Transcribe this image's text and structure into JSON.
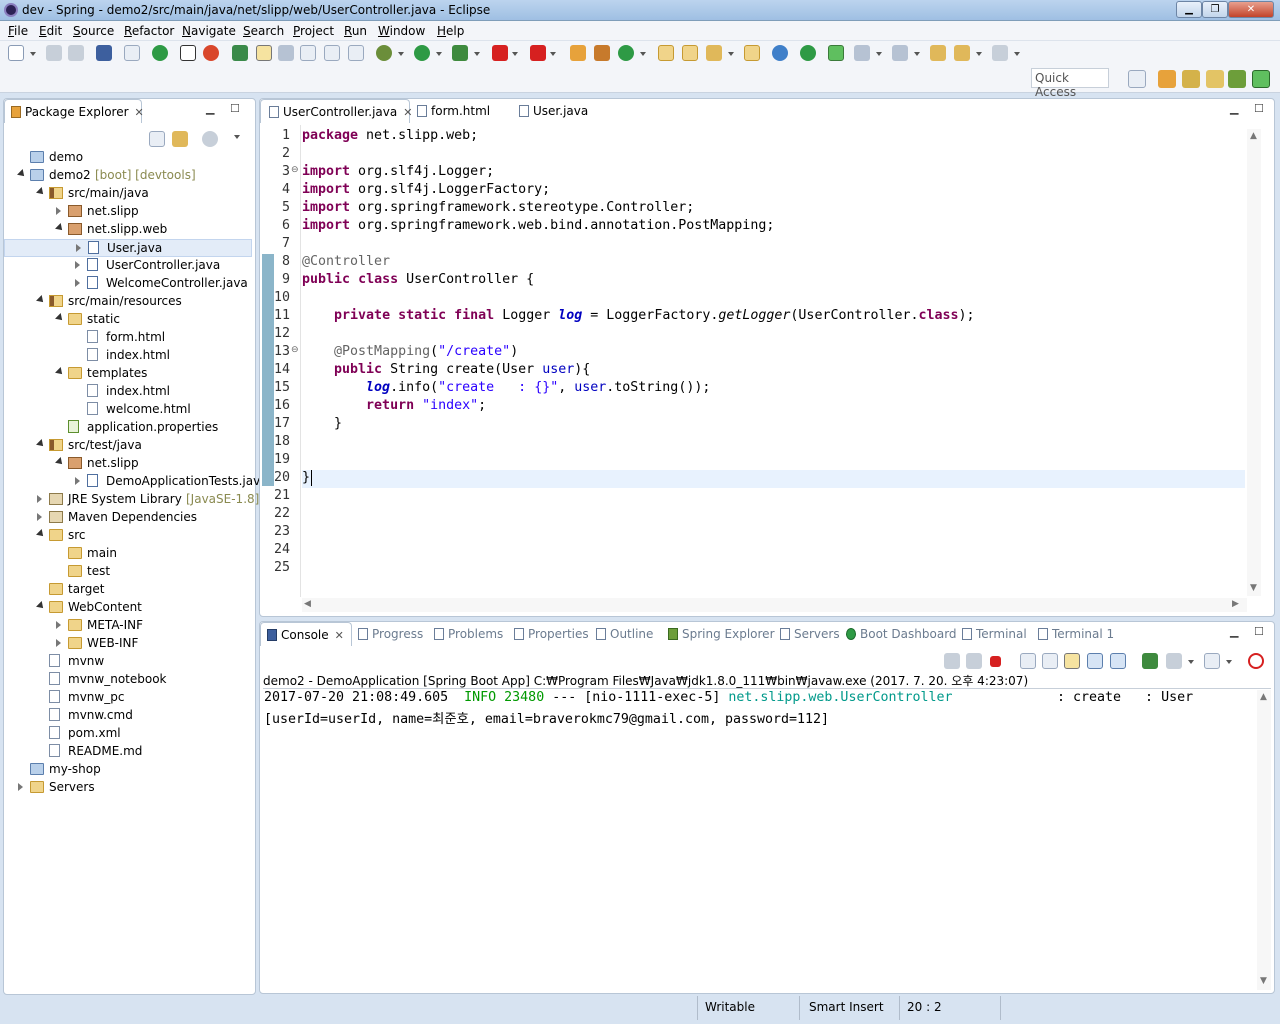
{
  "window": {
    "title": "dev - Spring - demo2/src/main/java/net/slipp/web/UserController.java - Eclipse"
  },
  "menu": [
    "File",
    "Edit",
    "Source",
    "Refactor",
    "Navigate",
    "Search",
    "Project",
    "Run",
    "Window",
    "Help"
  ],
  "toolbar": {
    "quick_access": "Quick Access"
  },
  "package_explorer": {
    "title": "Package Explorer",
    "tree": [
      {
        "label": "demo",
        "icon": "project-icon",
        "twisty": "none"
      },
      {
        "label": "demo2",
        "decoration": "[boot] [devtools]",
        "icon": "project-icon",
        "twisty": "open"
      },
      {
        "label": "src/main/java",
        "icon": "source-folder-icon",
        "twisty": "open"
      },
      {
        "label": "net.slipp",
        "icon": "package-icon",
        "twisty": "closed"
      },
      {
        "label": "net.slipp.web",
        "icon": "package-icon",
        "twisty": "open"
      },
      {
        "label": "User.java",
        "icon": "java-file-icon",
        "twisty": "closed"
      },
      {
        "label": "UserController.java",
        "icon": "java-file-icon",
        "twisty": "closed"
      },
      {
        "label": "WelcomeController.java",
        "icon": "java-file-icon",
        "twisty": "closed"
      },
      {
        "label": "src/main/resources",
        "icon": "source-folder-icon",
        "twisty": "open"
      },
      {
        "label": "static",
        "icon": "folder-icon",
        "twisty": "open"
      },
      {
        "label": "form.html",
        "icon": "html-file-icon",
        "twisty": "none"
      },
      {
        "label": "index.html",
        "icon": "html-file-icon",
        "twisty": "none"
      },
      {
        "label": "templates",
        "icon": "folder-icon",
        "twisty": "open"
      },
      {
        "label": "index.html",
        "icon": "html-file-icon",
        "twisty": "none"
      },
      {
        "label": "welcome.html",
        "icon": "html-file-icon",
        "twisty": "none"
      },
      {
        "label": "application.properties",
        "icon": "properties-file-icon",
        "twisty": "none"
      },
      {
        "label": "src/test/java",
        "icon": "source-folder-icon",
        "twisty": "open"
      },
      {
        "label": "net.slipp",
        "icon": "package-icon",
        "twisty": "open"
      },
      {
        "label": "DemoApplicationTests.java",
        "icon": "java-file-icon",
        "twisty": "closed"
      },
      {
        "label": "JRE System Library",
        "decoration": "[JavaSE-1.8]",
        "icon": "library-icon",
        "twisty": "closed"
      },
      {
        "label": "Maven Dependencies",
        "icon": "library-icon",
        "twisty": "closed"
      },
      {
        "label": "src",
        "icon": "folder-icon",
        "twisty": "open"
      },
      {
        "label": "main",
        "icon": "folder-icon",
        "twisty": "none"
      },
      {
        "label": "test",
        "icon": "folder-icon",
        "twisty": "none"
      },
      {
        "label": "target",
        "icon": "folder-icon",
        "twisty": "none"
      },
      {
        "label": "WebContent",
        "icon": "folder-icon",
        "twisty": "open"
      },
      {
        "label": "META-INF",
        "icon": "folder-icon",
        "twisty": "closed"
      },
      {
        "label": "WEB-INF",
        "icon": "folder-icon",
        "twisty": "closed"
      },
      {
        "label": "mvnw",
        "icon": "file-icon",
        "twisty": "none"
      },
      {
        "label": "mvnw_notebook",
        "icon": "file-icon",
        "twisty": "none"
      },
      {
        "label": "mvnw_pc",
        "icon": "file-icon",
        "twisty": "none"
      },
      {
        "label": "mvnw.cmd",
        "icon": "file-icon",
        "twisty": "none"
      },
      {
        "label": "pom.xml",
        "icon": "xml-file-icon",
        "twisty": "none"
      },
      {
        "label": "README.md",
        "icon": "file-icon",
        "twisty": "none"
      },
      {
        "label": "my-shop",
        "icon": "project-icon",
        "twisty": "none"
      },
      {
        "label": "Servers",
        "icon": "folder-icon",
        "twisty": "closed"
      }
    ]
  },
  "editor": {
    "tabs": [
      "UserController.java",
      "form.html",
      "User.java"
    ],
    "line_numbers": [
      "1",
      "2",
      "3",
      "4",
      "5",
      "6",
      "7",
      "8",
      "9",
      "10",
      "11",
      "12",
      "13",
      "14",
      "15",
      "16",
      "17",
      "18",
      "19",
      "20",
      "21",
      "22",
      "23",
      "24",
      "25"
    ],
    "code": [
      [
        {
          "t": "package",
          "k": "kw"
        },
        {
          "t": " net.slipp.web;"
        }
      ],
      [],
      [
        {
          "t": "import",
          "k": "kw"
        },
        {
          "t": " org.slf4j.Logger;"
        }
      ],
      [
        {
          "t": "import",
          "k": "kw"
        },
        {
          "t": " org.slf4j.LoggerFactory;"
        }
      ],
      [
        {
          "t": "import",
          "k": "kw"
        },
        {
          "t": " org.springframework.stereotype.Controller;"
        }
      ],
      [
        {
          "t": "import",
          "k": "kw"
        },
        {
          "t": " org.springframework.web.bind.annotation.PostMapping;"
        }
      ],
      [],
      [
        {
          "t": "@Controller",
          "k": "ann"
        }
      ],
      [
        {
          "t": "public",
          "k": "kw"
        },
        {
          "t": " "
        },
        {
          "t": "class",
          "k": "kw"
        },
        {
          "t": " UserController {"
        }
      ],
      [],
      [
        {
          "t": "    "
        },
        {
          "t": "private",
          "k": "kw"
        },
        {
          "t": " "
        },
        {
          "t": "static",
          "k": "kw"
        },
        {
          "t": " "
        },
        {
          "t": "final",
          "k": "kw"
        },
        {
          "t": " Logger "
        },
        {
          "t": "log",
          "k": "fld"
        },
        {
          "t": " = LoggerFactory."
        },
        {
          "t": "getLogger",
          "k": "stat"
        },
        {
          "t": "(UserController."
        },
        {
          "t": "class",
          "k": "kw"
        },
        {
          "t": ");"
        }
      ],
      [],
      [
        {
          "t": "    "
        },
        {
          "t": "@PostMapping",
          "k": "ann"
        },
        {
          "t": "("
        },
        {
          "t": "\"/create\"",
          "k": "str"
        },
        {
          "t": ")"
        }
      ],
      [
        {
          "t": "    "
        },
        {
          "t": "public",
          "k": "kw"
        },
        {
          "t": " String create(User "
        },
        {
          "t": "user",
          "k": "cls"
        },
        {
          "t": "){"
        }
      ],
      [
        {
          "t": "        "
        },
        {
          "t": "log",
          "k": "fld"
        },
        {
          "t": ".info("
        },
        {
          "t": "\"create   : {}\"",
          "k": "str"
        },
        {
          "t": ", "
        },
        {
          "t": "user",
          "k": "cls"
        },
        {
          "t": ".toString());"
        }
      ],
      [
        {
          "t": "        "
        },
        {
          "t": "return",
          "k": "kw"
        },
        {
          "t": " "
        },
        {
          "t": "\"index\"",
          "k": "str"
        },
        {
          "t": ";"
        }
      ],
      [
        {
          "t": "    }"
        }
      ],
      [],
      [],
      [
        {
          "t": "}"
        }
      ],
      [],
      [],
      [],
      [],
      []
    ]
  },
  "bottom_panel": {
    "tabs": [
      "Console",
      "Progress",
      "Problems",
      "Properties",
      "Outline",
      "Spring Explorer",
      "Servers",
      "Boot Dashboard",
      "Terminal",
      "Terminal 1"
    ],
    "console_header": "demo2 - DemoApplication [Spring Boot App] C:₩Program Files₩Java₩jdk1.8.0_111₩bin₩javaw.exe (2017. 7. 20. 오후 4:23:07)",
    "log_line_1": {
      "timestamp": "2017-07-20 21:08:49.605",
      "level": "INFO 23480",
      "thread": "--- [nio-1111-exec-5]",
      "logger": "net.slipp.web.UserController",
      "message": ": create   : User"
    },
    "log_line_2": "[userId=userId, name=최준호, email=braverokmc79@gmail.com, password=112]"
  },
  "status": {
    "writable": "Writable",
    "insert_mode": "Smart Insert",
    "position": "20 : 2"
  },
  "colors": {
    "keyword": "#7f0055",
    "string": "#2a00ff",
    "annotation": "#646464",
    "field": "#0000c0",
    "current_line": "#e8f2fe"
  }
}
